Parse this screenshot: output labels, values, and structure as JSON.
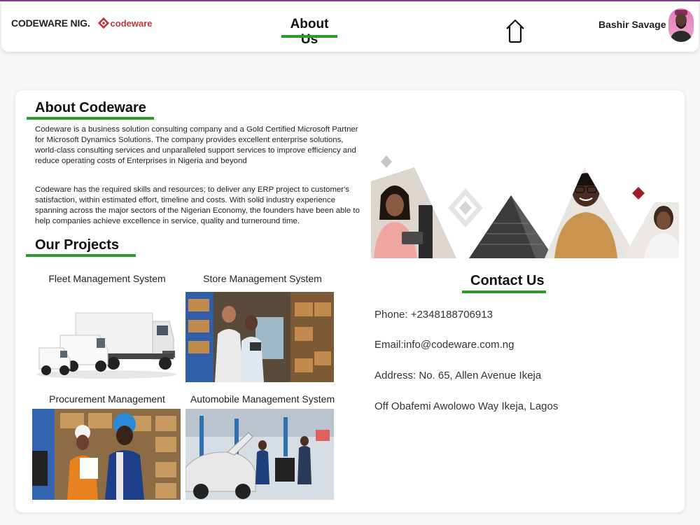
{
  "header": {
    "brand_text": "CODEWARE NIG.",
    "logo_text": "codeware",
    "nav_title": "About Us",
    "home_icon": "home-icon",
    "user_name": "Bashir Savage"
  },
  "about": {
    "title": "About Codeware",
    "paragraph1": "Codeware is a business solution consulting company and a Gold Certified Microsoft Partner for Microsoft Dynamics Solutions. The company provides excellent enterprise solutions, world-class consulting services and unparalleled support services to improve efficiency and reduce operating costs of Enterprises in Nigeria and beyond",
    "paragraph2": "Codeware has the required skills and resources; to deliver any ERP project to customer's satisfaction, within estimated effort, timeline and costs. With solid industry experience spanning across the major sectors of the Nigerian Economy, the founders have been able to help companies achieve excellence in service, quality and turneround time."
  },
  "projects": {
    "title": "Our Projects",
    "items": [
      {
        "label": "Fleet Management System"
      },
      {
        "label": "Store Management System"
      },
      {
        "label": "Procurement Management"
      },
      {
        "label": "Automobile Management System"
      }
    ]
  },
  "contact": {
    "title": "Contact Us",
    "phone": "Phone: +2348188706913",
    "email": "Email:info@codeware.com.ng",
    "address": "Address: No. 65, Allen Avenue Ikeja",
    "address2": "Off Obafemi Awolowo Way Ikeja, Lagos"
  },
  "colors": {
    "accent_green": "#2e9a2e",
    "brand_red": "#c0333a",
    "top_border": "#8a3d8f"
  }
}
